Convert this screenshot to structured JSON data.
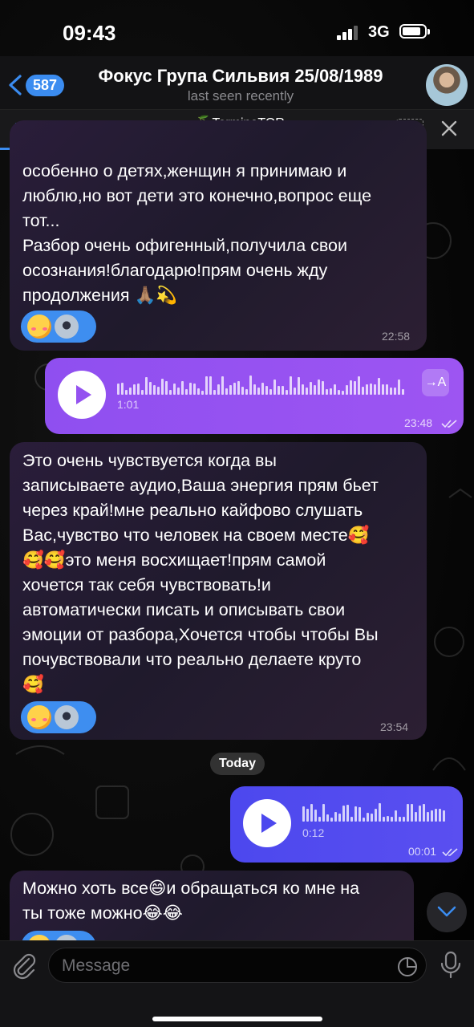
{
  "status_bar": {
    "time": "09:43",
    "network": "3G"
  },
  "header": {
    "back_count": "587",
    "title": "Фокус Група Сильвия 25/08/1989",
    "subtitle": "last seen recently"
  },
  "player": {
    "author": "~🍒TerminaTOR",
    "type": "Voice Message",
    "speed": "1X",
    "progress": 0.71
  },
  "messages": [
    {
      "text": "особенно о детях,женщин я принимаю и\nлюблю,но вот дети это конечно,вопрос еще\nтот...\nРазбор очень офигенный,получила свои\nосознания!благодарю!прям очень жду\nпродолжения 🙏🏽💫",
      "time": "22:58"
    },
    {
      "voice_duration": "1:01",
      "time": "23:48",
      "transcribe_label": "→A"
    },
    {
      "text": "Это очень чувствуется когда вы\nзаписываете аудио,Ваша энергия прям бьет\nчерез край!мне реально кайфово слушать\nВас,чувство что человек на своем месте🥰\n🥰🥰это меня восхищает!прям самой\nхочется так себя чувствовать!и\nавтоматически писать и описывать свои\nэмоции от разбора,Хочется чтобы чтобы Вы\nпочувствовали что реально делаете круто\n🥰",
      "time": "23:54"
    },
    {
      "date_separator": "Today"
    },
    {
      "voice_duration": "0:12",
      "time": "00:01"
    },
    {
      "text": "Можно хоть все😄и обращаться ко мне на\nты тоже можно😂😂"
    }
  ],
  "input": {
    "placeholder": "Message"
  }
}
